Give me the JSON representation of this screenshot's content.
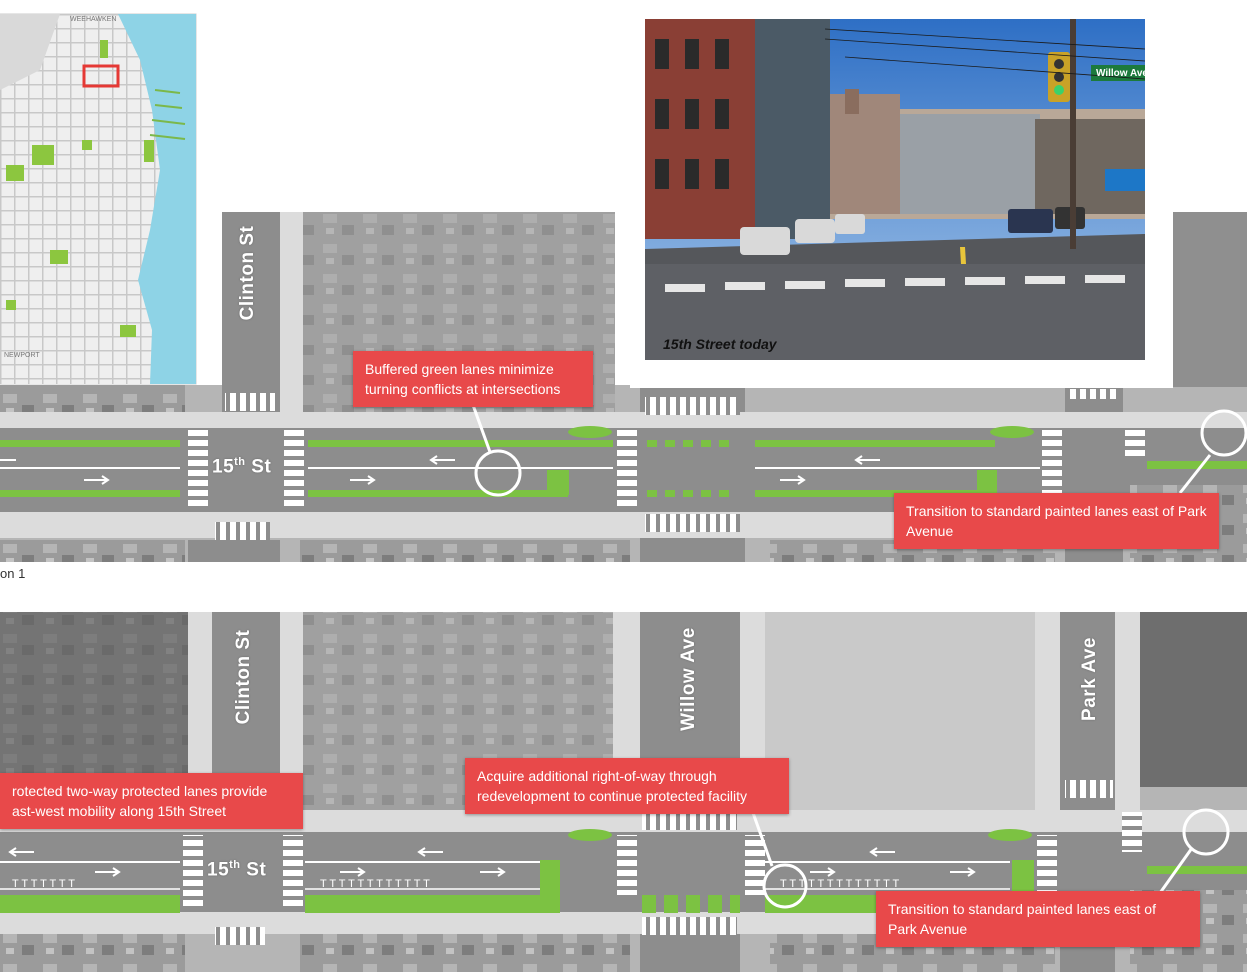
{
  "inset_map": {
    "labels": {
      "top": "WEEHAWKEN",
      "bottom": "NEWPORT"
    },
    "colors": {
      "water": "#8ed3e6",
      "park": "#8cc63f",
      "highlight": "#e53935"
    }
  },
  "photo": {
    "caption": "15th Street today",
    "sign_text": "Willow Ave"
  },
  "option1": {
    "label": "on 1",
    "streets": {
      "cross": "15",
      "cross_sup": "th",
      "cross_suffix": " St",
      "clinton": "Clinton St"
    },
    "callouts": {
      "buffered": "Buffered green lanes minimize turning conflicts at intersections",
      "transition": "Transition to standard painted lanes east of Park Avenue"
    }
  },
  "option2": {
    "streets": {
      "cross": "15",
      "cross_sup": "th",
      "cross_suffix": " St",
      "clinton": "Clinton St",
      "willow": "Willow Ave",
      "park": "Park Ave"
    },
    "callouts": {
      "protected": "rotected two-way protected lanes provide\nast-west mobility along 15th Street",
      "acquire": "Acquire additional right-of-way through redevelopment to continue protected facility",
      "transition": "Transition to standard painted lanes east of Park Avenue"
    }
  },
  "colors": {
    "callout": "#e8494a",
    "bike_lane": "#7cc242",
    "road": "#8d8d8d",
    "sidewalk": "#dcdcdc"
  }
}
